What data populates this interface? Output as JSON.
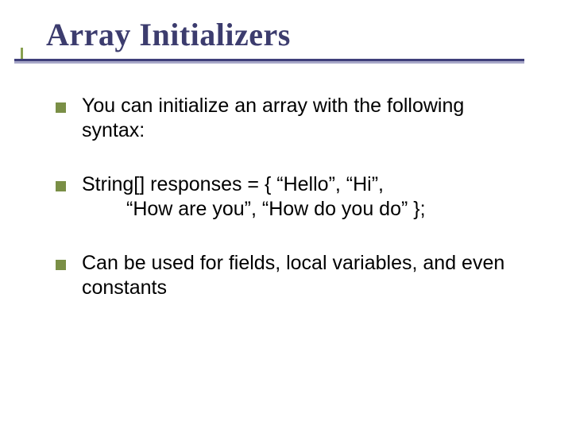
{
  "slide": {
    "title": "Array Initializers",
    "bullets": [
      {
        "text": "You can initialize an array with the following syntax:"
      },
      {
        "line1": "String[] responses = { “Hello”, “Hi”,",
        "line2": "“How are you”, “How do you do” };"
      },
      {
        "text": "Can be used for fields, local variables, and even constants"
      }
    ]
  }
}
